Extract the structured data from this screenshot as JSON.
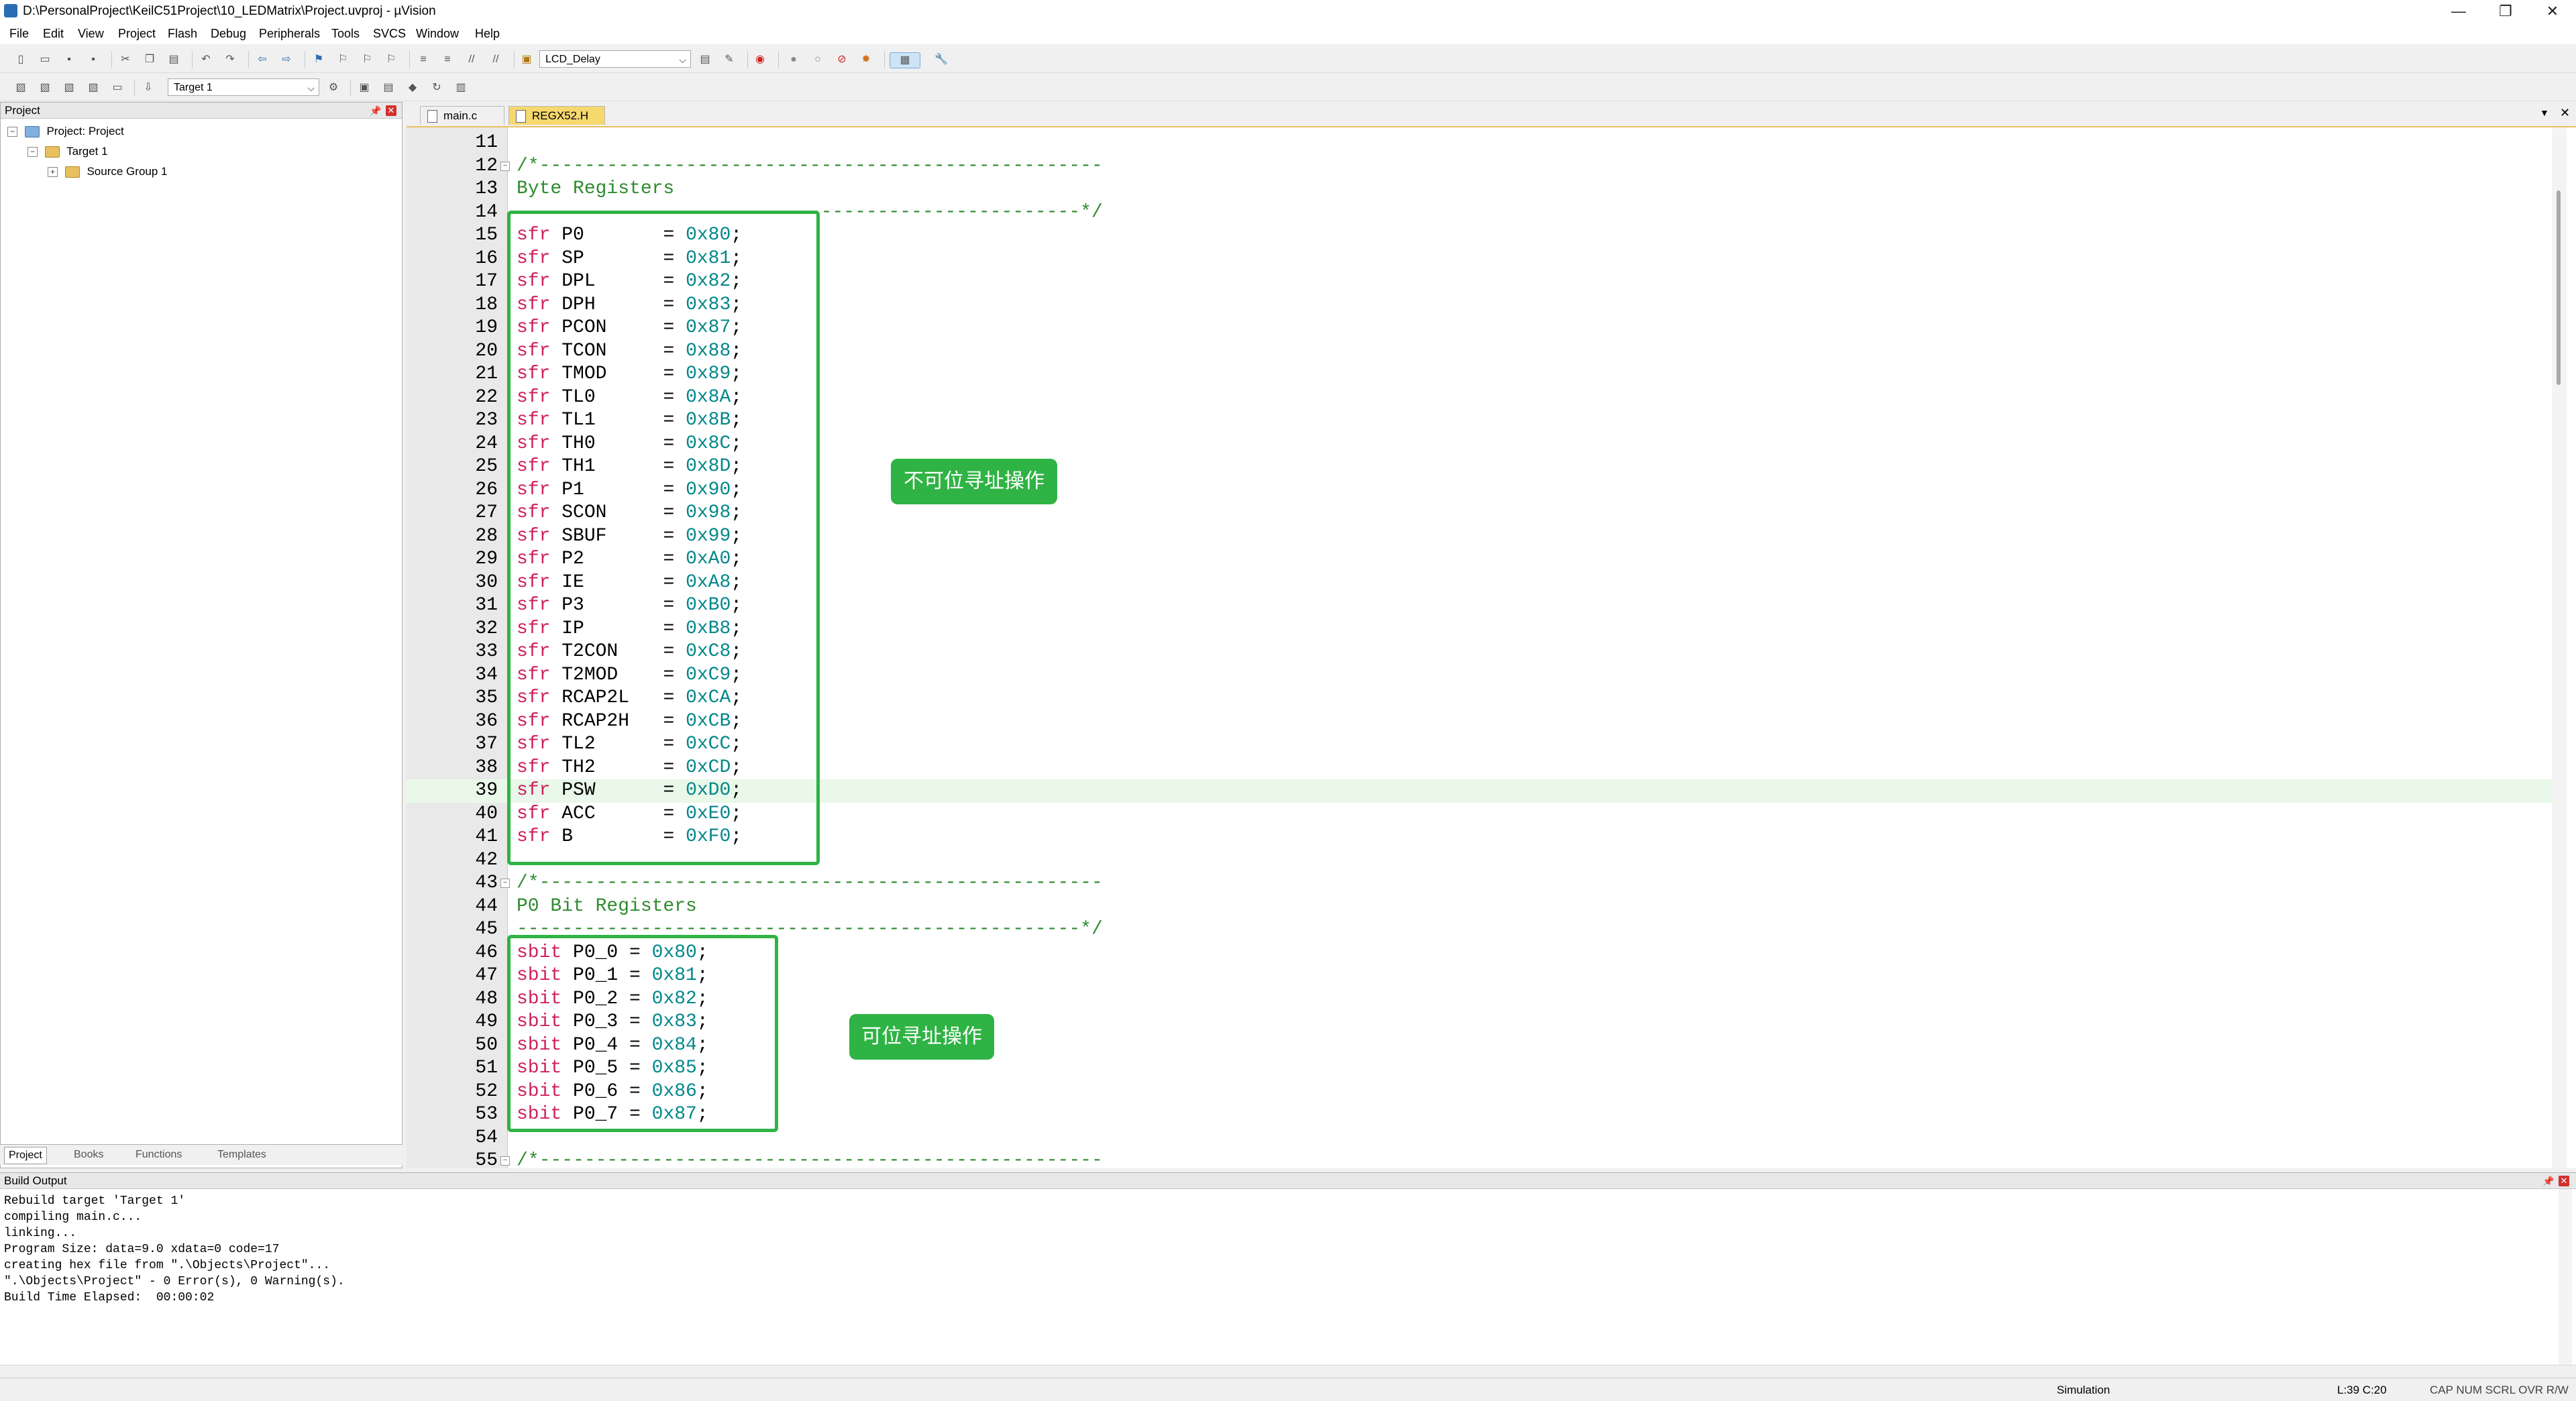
{
  "window": {
    "title": "D:\\PersonalProject\\KeilC51Project\\10_LEDMatrix\\Project.uvproj - µVision",
    "min_glyph": "—",
    "max_glyph": "❐",
    "close_glyph": "✕"
  },
  "menu": [
    "File",
    "Edit",
    "View",
    "Project",
    "Flash",
    "Debug",
    "Peripherals",
    "Tools",
    "SVCS",
    "Window",
    "Help"
  ],
  "toolbar": {
    "function_combo": "LCD_Delay",
    "target_combo": "Target 1"
  },
  "project_panel": {
    "title": "Project",
    "tree": [
      "Project: Project",
      "Target 1",
      "Source Group 1"
    ],
    "tabs": [
      "Project",
      "Books",
      "Functions",
      "Templates"
    ]
  },
  "editor": {
    "tabs": [
      "main.c",
      "REGX52.H"
    ],
    "active_tab": "REGX52.H",
    "lines": [
      {
        "n": "11",
        "t": ""
      },
      {
        "n": "12",
        "t": "/*--------------------------------------------------"
      },
      {
        "n": "13",
        "t": "Byte Registers"
      },
      {
        "n": "14",
        "t": "--------------------------------------------------*/"
      },
      {
        "n": "15",
        "k": "sfr",
        "r": "P0      ",
        "v": "0x80"
      },
      {
        "n": "16",
        "k": "sfr",
        "r": "SP      ",
        "v": "0x81"
      },
      {
        "n": "17",
        "k": "sfr",
        "r": "DPL     ",
        "v": "0x82"
      },
      {
        "n": "18",
        "k": "sfr",
        "r": "DPH     ",
        "v": "0x83"
      },
      {
        "n": "19",
        "k": "sfr",
        "r": "PCON    ",
        "v": "0x87"
      },
      {
        "n": "20",
        "k": "sfr",
        "r": "TCON    ",
        "v": "0x88"
      },
      {
        "n": "21",
        "k": "sfr",
        "r": "TMOD    ",
        "v": "0x89"
      },
      {
        "n": "22",
        "k": "sfr",
        "r": "TL0     ",
        "v": "0x8A"
      },
      {
        "n": "23",
        "k": "sfr",
        "r": "TL1     ",
        "v": "0x8B"
      },
      {
        "n": "24",
        "k": "sfr",
        "r": "TH0     ",
        "v": "0x8C"
      },
      {
        "n": "25",
        "k": "sfr",
        "r": "TH1     ",
        "v": "0x8D"
      },
      {
        "n": "26",
        "k": "sfr",
        "r": "P1      ",
        "v": "0x90"
      },
      {
        "n": "27",
        "k": "sfr",
        "r": "SCON    ",
        "v": "0x98"
      },
      {
        "n": "28",
        "k": "sfr",
        "r": "SBUF    ",
        "v": "0x99"
      },
      {
        "n": "29",
        "k": "sfr",
        "r": "P2      ",
        "v": "0xA0"
      },
      {
        "n": "30",
        "k": "sfr",
        "r": "IE      ",
        "v": "0xA8"
      },
      {
        "n": "31",
        "k": "sfr",
        "r": "P3      ",
        "v": "0xB0"
      },
      {
        "n": "32",
        "k": "sfr",
        "r": "IP      ",
        "v": "0xB8"
      },
      {
        "n": "33",
        "k": "sfr",
        "r": "T2CON   ",
        "v": "0xC8"
      },
      {
        "n": "34",
        "k": "sfr",
        "r": "T2MOD   ",
        "v": "0xC9"
      },
      {
        "n": "35",
        "k": "sfr",
        "r": "RCAP2L  ",
        "v": "0xCA"
      },
      {
        "n": "36",
        "k": "sfr",
        "r": "RCAP2H  ",
        "v": "0xCB"
      },
      {
        "n": "37",
        "k": "sfr",
        "r": "TL2     ",
        "v": "0xCC"
      },
      {
        "n": "38",
        "k": "sfr",
        "r": "TH2     ",
        "v": "0xCD"
      },
      {
        "n": "39",
        "k": "sfr",
        "r": "PSW     ",
        "v": "0xD0"
      },
      {
        "n": "40",
        "k": "sfr",
        "r": "ACC     ",
        "v": "0xE0"
      },
      {
        "n": "41",
        "k": "sfr",
        "r": "B       ",
        "v": "0xF0"
      },
      {
        "n": "42",
        "t": ""
      },
      {
        "n": "43",
        "t": "/*--------------------------------------------------"
      },
      {
        "n": "44",
        "t": "P0 Bit Registers"
      },
      {
        "n": "45",
        "t": "--------------------------------------------------*/"
      },
      {
        "n": "46",
        "k": "sbit",
        "r": "P0_0",
        "v": "0x80"
      },
      {
        "n": "47",
        "k": "sbit",
        "r": "P0_1",
        "v": "0x81"
      },
      {
        "n": "48",
        "k": "sbit",
        "r": "P0_2",
        "v": "0x82"
      },
      {
        "n": "49",
        "k": "sbit",
        "r": "P0_3",
        "v": "0x83"
      },
      {
        "n": "50",
        "k": "sbit",
        "r": "P0_4",
        "v": "0x84"
      },
      {
        "n": "51",
        "k": "sbit",
        "r": "P0_5",
        "v": "0x85"
      },
      {
        "n": "52",
        "k": "sbit",
        "r": "P0_6",
        "v": "0x86"
      },
      {
        "n": "53",
        "k": "sbit",
        "r": "P0_7",
        "v": "0x87"
      },
      {
        "n": "54",
        "t": ""
      },
      {
        "n": "55",
        "t": "/*--------------------------------------------------"
      }
    ],
    "highlighted_line": "39",
    "annotations": {
      "byte_regs_label": "不可位寻址操作",
      "bit_regs_label": "可位寻址操作"
    }
  },
  "build_output": {
    "title": "Build Output",
    "text": "Rebuild target 'Target 1'\ncompiling main.c...\nlinking...\nProgram Size: data=9.0 xdata=0 code=17\ncreating hex file from \".\\Objects\\Project\"...\n\".\\Objects\\Project\" - 0 Error(s), 0 Warning(s).\nBuild Time Elapsed:  00:00:02"
  },
  "status": {
    "mode": "Simulation",
    "position": "L:39 C:20",
    "indicators": "CAP  NUM  SCRL  OVR  R/W"
  },
  "colors": {
    "annotation_green": "#2fb344",
    "keyword": "#d02060",
    "number": "#00878a",
    "comment": "#2e8b2e"
  }
}
